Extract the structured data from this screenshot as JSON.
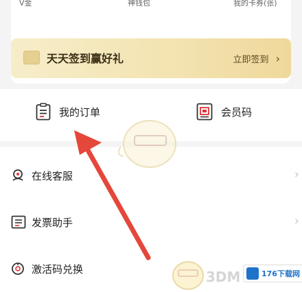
{
  "top": {
    "stats": [
      "V金",
      "神钱包",
      "我的卡券(张)"
    ]
  },
  "signin": {
    "title": "天天签到赢好礼",
    "action": "立即签到",
    "chevron": "›"
  },
  "orders": {
    "my_orders_label": "我的订单",
    "member_code_label": "会员码"
  },
  "list": {
    "items": [
      {
        "label": "在线客服",
        "icon": "headset-icon"
      },
      {
        "label": "发票助手",
        "icon": "invoice-icon"
      },
      {
        "label": "激活码兑换",
        "icon": "activation-code-icon"
      }
    ],
    "chevron": "›"
  },
  "watermarks": {
    "site_3dm": "3DM",
    "site_176_logo": "176下载网"
  },
  "colors": {
    "signin_bg": "#f3e3b0",
    "arrow": "#e5473a",
    "page_bg": "#f4f4f4"
  }
}
